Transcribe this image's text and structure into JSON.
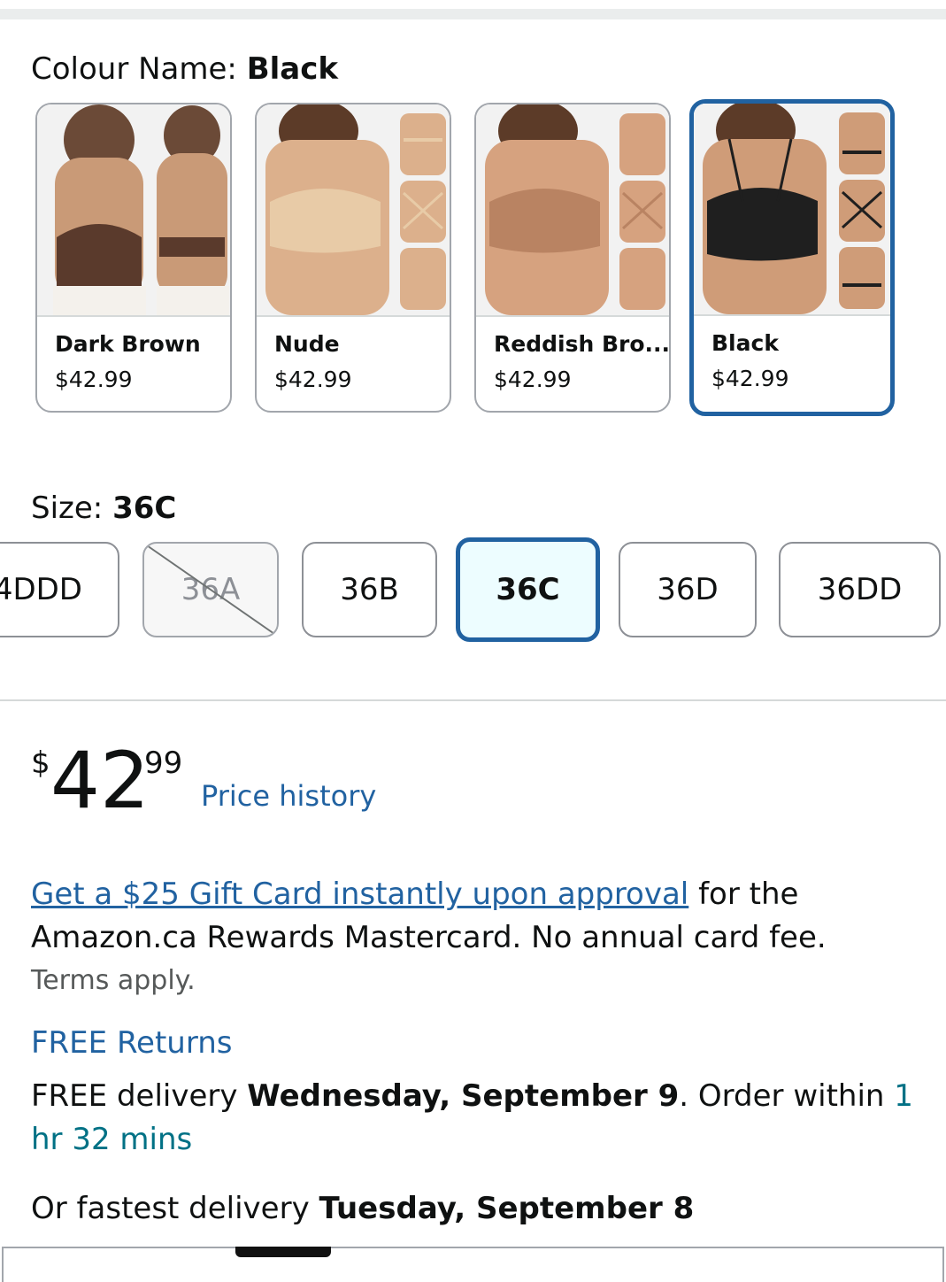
{
  "colour": {
    "label_prefix": "Colour Name: ",
    "selected": "Black",
    "swatches": [
      {
        "name": "Dark Brown",
        "price": "$42.99",
        "color": "#5a3a2c",
        "skin": "#c99a77"
      },
      {
        "name": "Nude",
        "price": "$42.99",
        "color": "#e8cba7",
        "skin": "#dcb08c"
      },
      {
        "name": "Reddish Bro...",
        "price": "$42.99",
        "color": "#b98362",
        "skin": "#d6a27f"
      },
      {
        "name": "Black",
        "price": "$42.99",
        "color": "#1f1f1f",
        "skin": "#cf9c78"
      }
    ]
  },
  "size": {
    "label_prefix": "Size: ",
    "selected": "36C",
    "options": [
      "4DDD",
      "36A",
      "36B",
      "36C",
      "36D",
      "36DD"
    ]
  },
  "price": {
    "symbol": "$",
    "whole": "42",
    "fraction": "99",
    "history_link": "Price history"
  },
  "promo": {
    "link_text": "Get a $25 Gift Card instantly upon approval",
    "rest_text": " for the Amazon.ca Rewards Mastercard. No annual card fee.",
    "terms": "Terms apply."
  },
  "returns": {
    "label": "FREE Returns"
  },
  "delivery": {
    "prefix": "FREE delivery ",
    "date": "Wednesday, September 9",
    "middle": ". Order within ",
    "countdown": "1 hr 32 mins"
  },
  "fastest": {
    "prefix": "Or fastest delivery ",
    "date": "Tuesday, September 8"
  },
  "colors": {
    "link": "#2162a1",
    "selected_border": "#2162a1",
    "countdown": "#007185"
  }
}
